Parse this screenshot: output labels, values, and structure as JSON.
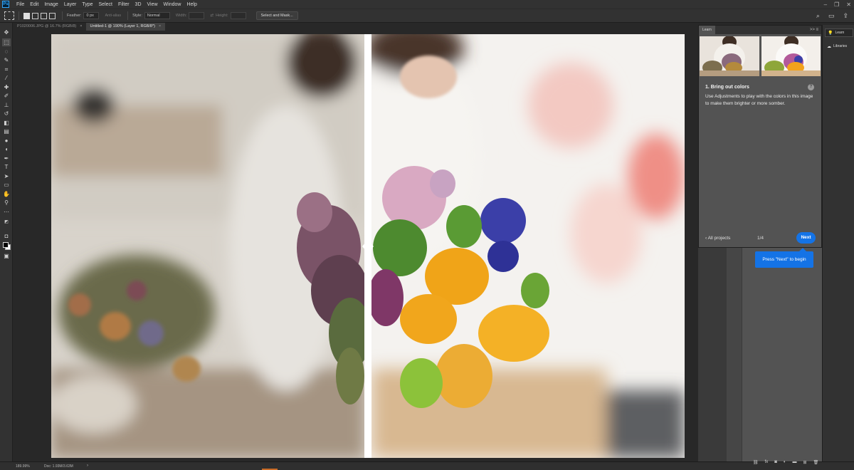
{
  "app": {
    "logo": "Ps"
  },
  "menu": [
    "File",
    "Edit",
    "Image",
    "Layer",
    "Type",
    "Select",
    "Filter",
    "3D",
    "View",
    "Window",
    "Help"
  ],
  "window_controls": [
    "–",
    "❐",
    "✕"
  ],
  "options": {
    "feather_label": "Feather:",
    "feather_value": "0 px",
    "antialias_label": "Anti-alias",
    "style_label": "Style:",
    "style_value": "Normal",
    "width_label": "Width:",
    "height_label": "Height:",
    "select_mask_label": "Select and Mask..."
  },
  "tabs": [
    {
      "title": "P1020006.JPG @ 16.7% (RGB/8)",
      "close": "×"
    },
    {
      "title": "Untitled-1 @ 190% (Layer 1, RGB/8*)",
      "close": "×"
    }
  ],
  "status": {
    "zoom": "189.99%",
    "doc": "Doc: 1.93M/3.63M",
    "arrow": "›"
  },
  "learn": {
    "tab_label": "Learn",
    "header_icons": ">> ≡",
    "step_title": "1.  Bring out colors",
    "help": "?",
    "description": "Use Adjustments to play with the colors in this image to make them brighter or more somber.",
    "all_projects": "‹  All projects",
    "step_count": "1/4",
    "next_label": "Next"
  },
  "tooltip": {
    "text": "Press \"Next\" to begin"
  },
  "dock": {
    "learn_label": "Learn",
    "libraries_label": "Libraries"
  },
  "colors": {
    "accent": "#1473e6",
    "panel": "#535353",
    "chrome": "#323232"
  }
}
